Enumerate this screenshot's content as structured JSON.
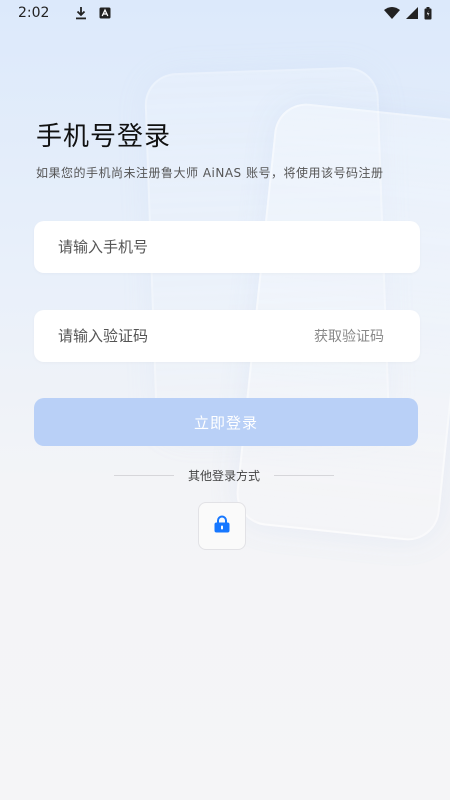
{
  "status_bar": {
    "time": "2:02",
    "icons": [
      "download-icon",
      "notification-a-icon",
      "wifi-icon",
      "signal-icon",
      "battery-icon"
    ]
  },
  "header": {
    "title": "手机号登录",
    "subtitle": "如果您的手机尚未注册鲁大师 AiNAS 账号，将使用该号码注册"
  },
  "form": {
    "phone_placeholder": "请输入手机号",
    "phone_value": "",
    "code_placeholder": "请输入验证码",
    "code_value": "",
    "get_code_label": "获取验证码",
    "login_label": "立即登录"
  },
  "other_login": {
    "label": "其他登录方式",
    "icon": "lock-icon"
  },
  "colors": {
    "accent": "#1677ff",
    "login_button_disabled": "#b9d0f7"
  }
}
